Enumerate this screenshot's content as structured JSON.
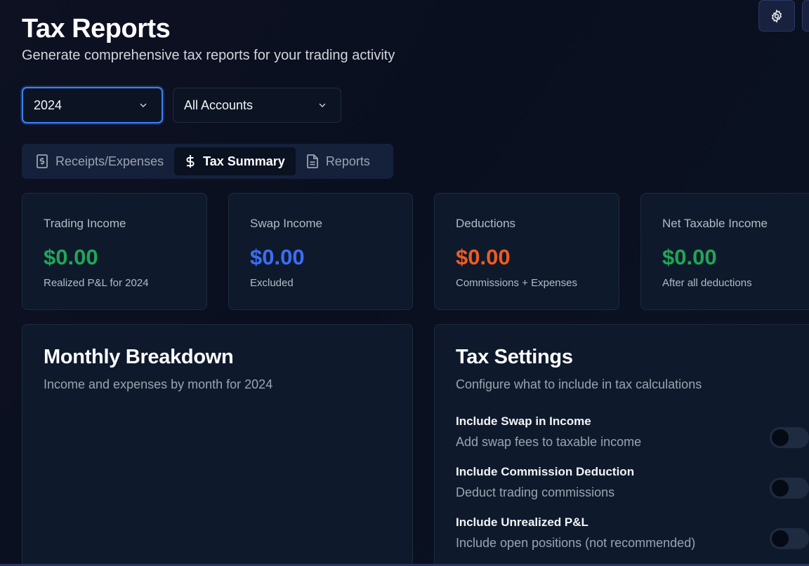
{
  "header": {
    "title": "Tax Reports",
    "subtitle": "Generate comprehensive tax reports for your trading activity"
  },
  "top_actions": [
    {
      "icon": "settings-icon"
    },
    {
      "icon": "more"
    }
  ],
  "filters": {
    "year": "2024",
    "account": "All Accounts"
  },
  "tabs": [
    {
      "label": "Receipts/Expenses",
      "icon": "receipt-icon",
      "active": false
    },
    {
      "label": "Tax Summary",
      "icon": "dollar-icon",
      "active": true
    },
    {
      "label": "Reports",
      "icon": "document-icon",
      "active": false
    }
  ],
  "stats": [
    {
      "label": "Trading Income",
      "value": "$0.00",
      "sub": "Realized P&L for 2024",
      "color": "#22a556"
    },
    {
      "label": "Swap Income",
      "value": "$0.00",
      "sub": "Excluded",
      "color": "#3b6ef5"
    },
    {
      "label": "Deductions",
      "value": "$0.00",
      "sub": "Commissions + Expenses",
      "color": "#ef5b1f"
    },
    {
      "label": "Net Taxable Income",
      "value": "$0.00",
      "sub": "After all deductions",
      "color": "#22a556"
    }
  ],
  "monthly": {
    "title": "Monthly Breakdown",
    "description": "Income and expenses by month for 2024"
  },
  "tax_settings": {
    "title": "Tax Settings",
    "description": "Configure what to include in tax calculations",
    "items": [
      {
        "name": "Include Swap in Income",
        "description": "Add swap fees to taxable income",
        "enabled": false
      },
      {
        "name": "Include Commission Deduction",
        "description": "Deduct trading commissions",
        "enabled": false
      },
      {
        "name": "Include Unrealized P&L",
        "description": "Include open positions (not recommended)",
        "enabled": false
      }
    ]
  }
}
